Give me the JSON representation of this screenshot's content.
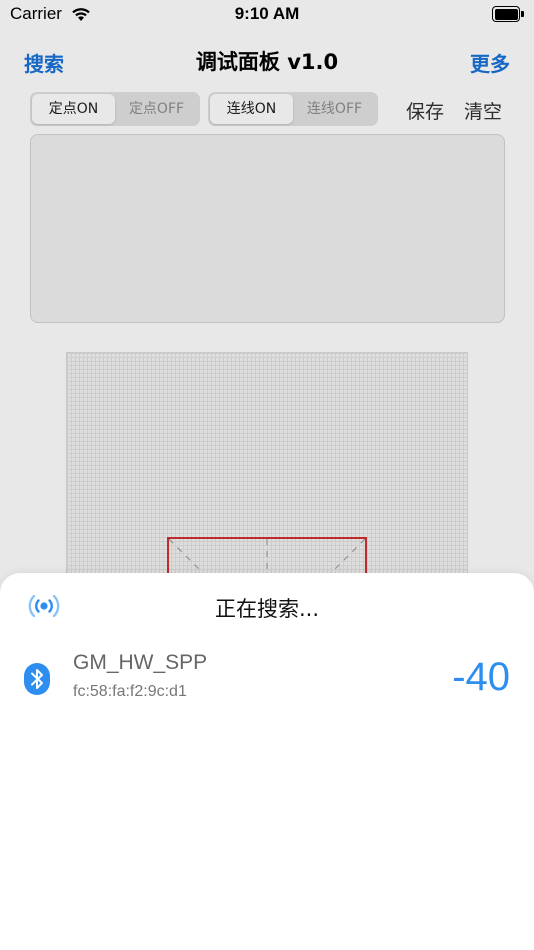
{
  "status_bar": {
    "carrier": "Carrier",
    "time": "9:10 AM",
    "wifi_icon": "wifi-icon",
    "battery_icon": "battery-icon"
  },
  "nav": {
    "left_label": "搜索",
    "title": "调试面板 v1.0",
    "right_label": "更多"
  },
  "toolbar": {
    "point_segment": {
      "on_label": "定点ON",
      "off_label": "定点OFF",
      "selected": "on"
    },
    "line_segment": {
      "on_label": "连线ON",
      "off_label": "连线OFF",
      "selected": "on"
    },
    "save_label": "保存",
    "clear_label": "清空"
  },
  "sheet": {
    "title": "正在搜索...",
    "scan_icon": "broadcast-icon",
    "devices": [
      {
        "name": "GM_HW_SPP",
        "mac": "fc:58:fa:f2:9c:d1",
        "rssi": "-40",
        "icon": "bluetooth-icon"
      }
    ]
  },
  "colors": {
    "accent": "#1a73d9",
    "rssi": "#2d8ef0",
    "target_outline": "#d32f2f"
  }
}
